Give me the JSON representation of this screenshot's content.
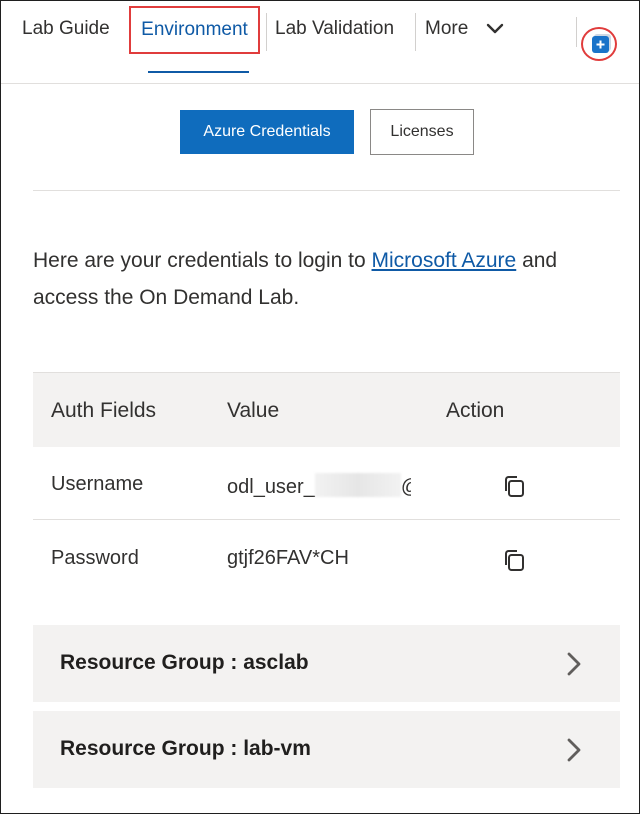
{
  "tabs": {
    "lab_guide": "Lab Guide",
    "environment": "Environment",
    "lab_validation": "Lab Validation",
    "more": "More"
  },
  "subtabs": {
    "azure_credentials": "Azure Credentials",
    "licenses": "Licenses"
  },
  "intro": {
    "before_link": "Here are your credentials to login to ",
    "link": "Microsoft Azure",
    "after_link": " and access the On Demand Lab."
  },
  "credentials": {
    "headers": {
      "auth_fields": "Auth Fields",
      "value": "Value",
      "action": "Action"
    },
    "rows": [
      {
        "field": "Username",
        "value_prefix": "odl_user_",
        "value_suffix": "@"
      },
      {
        "field": "Password",
        "value": "gtjf26FAV*CH"
      }
    ]
  },
  "resource_groups": [
    {
      "label": "Resource Group : asclab"
    },
    {
      "label": "Resource Group : lab-vm"
    }
  ],
  "colors": {
    "accent": "#0f6cbd",
    "link": "#0f5aa6",
    "highlight": "#e03c3c",
    "panel": "#f3f2f1"
  },
  "icons": {
    "more": "chevron-down-icon",
    "add": "add-icon",
    "copy": "copy-icon",
    "expand": "chevron-right-icon"
  }
}
